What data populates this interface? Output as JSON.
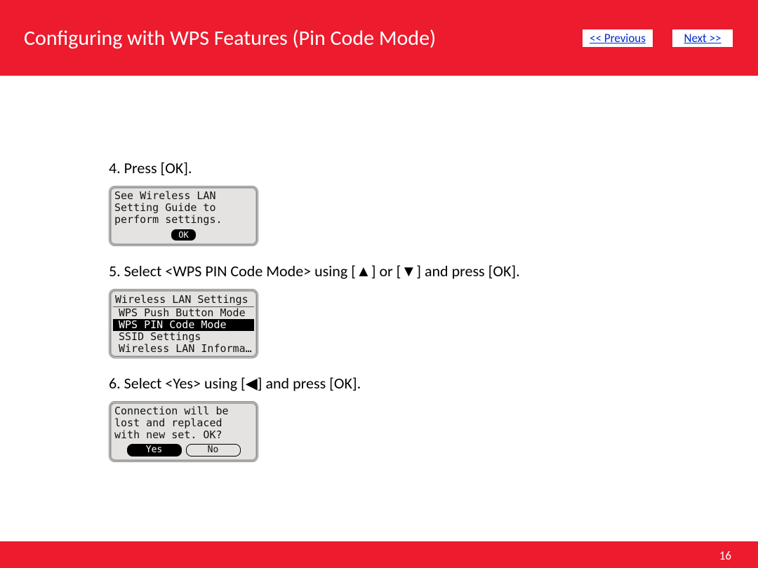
{
  "header": {
    "title": "Configuring with WPS Features (Pin Code Mode)",
    "prev": "<< Previous",
    "next": "Next >>"
  },
  "steps": {
    "s4": "4. Press [OK].",
    "s5a": "5. Select <WPS PIN Code Mode> using [",
    "s5b": "] or [",
    "s5c": "] and press [OK].",
    "s6a": "6. Select <Yes> using [",
    "s6b": "] and press [OK]."
  },
  "lcd1": {
    "l1": "See Wireless LAN",
    "l2": "Setting Guide to",
    "l3": "perform settings.",
    "ok": "OK"
  },
  "lcd2": {
    "title": "Wireless LAN Settings",
    "i1": "WPS Push Button Mode",
    "i2": "WPS PIN Code Mode",
    "i3": "SSID Settings",
    "i4": "Wireless LAN Informa…"
  },
  "lcd3": {
    "l1": "Connection will be",
    "l2": "lost and replaced",
    "l3": "with new set. OK?",
    "yes": "Yes",
    "no": "No"
  },
  "icons": {
    "up": "▲",
    "down": "▼",
    "left": "◀"
  },
  "footer": {
    "page": "16"
  }
}
